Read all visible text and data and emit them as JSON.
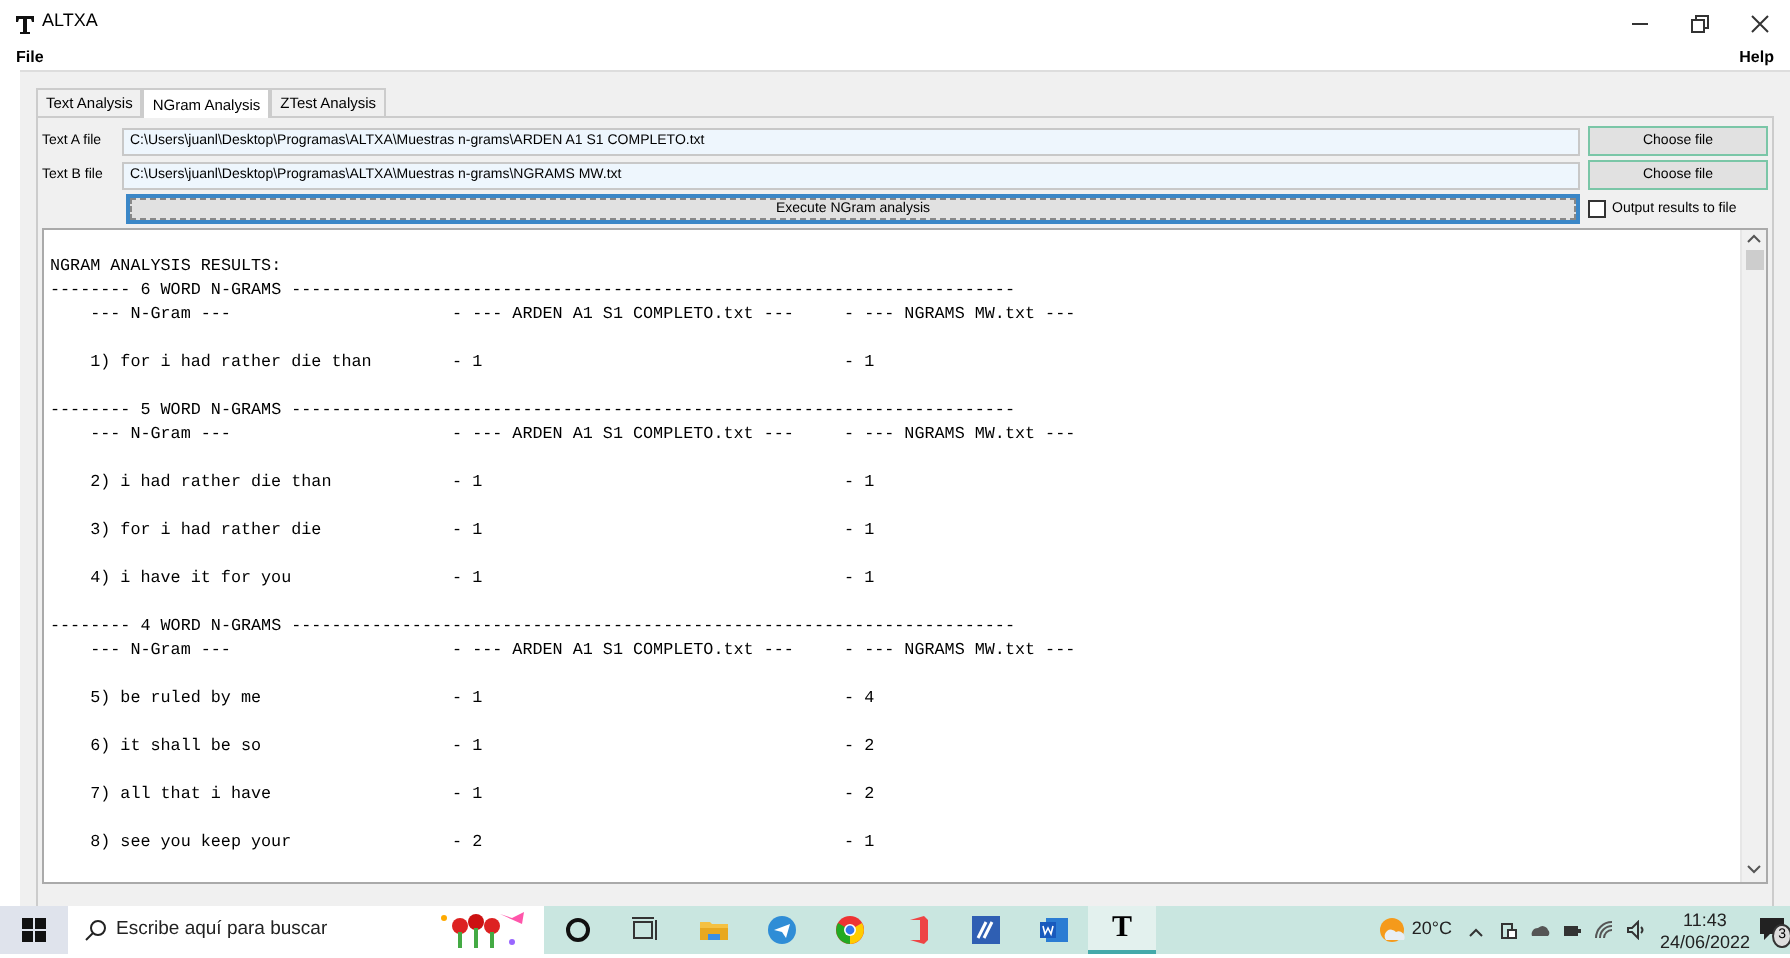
{
  "window": {
    "title": "ALTXA"
  },
  "menu": [
    "File",
    "Help"
  ],
  "tabs": [
    {
      "label": "Text Analysis",
      "selected": false
    },
    {
      "label": "NGram Analysis",
      "selected": true
    },
    {
      "label": "ZTest Analysis",
      "selected": false
    }
  ],
  "files": [
    {
      "label": "Text A file",
      "value": "C:\\Users\\juanl\\Desktop\\Programas\\ALTXA\\Muestras n-grams\\ARDEN A1 S1 COMPLETO.txt",
      "button": "Choose file"
    },
    {
      "label": "Text B file",
      "value": "C:\\Users\\juanl\\Desktop\\Programas\\ALTXA\\Muestras n-grams\\NGRAMS MW.txt",
      "button": "Choose file"
    }
  ],
  "execute_button": "Execute NGram analysis",
  "output_to_file": {
    "label": "Output results to file",
    "checked": false
  },
  "results": [
    {
      "kind": "title",
      "text": "NGRAM ANALYSIS RESULTS:"
    },
    {
      "kind": "rule",
      "text": "-------- 6 WORD N-GRAMS ------------------------------------------------------------------------"
    },
    {
      "kind": "header",
      "cells": [
        "--- N-Gram ---",
        "- --- ARDEN A1 S1 COMPLETO.txt ---",
        "- --- NGRAMS MW.txt ---"
      ]
    },
    {
      "kind": "item",
      "cells": [
        "1) for i had rather die than",
        "- 1",
        "- 1"
      ]
    },
    {
      "kind": "rule",
      "text": "-------- 5 WORD N-GRAMS ------------------------------------------------------------------------"
    },
    {
      "kind": "header",
      "cells": [
        "--- N-Gram ---",
        "- --- ARDEN A1 S1 COMPLETO.txt ---",
        "- --- NGRAMS MW.txt ---"
      ]
    },
    {
      "kind": "item",
      "cells": [
        "2) i had rather die than",
        "- 1",
        "- 1"
      ]
    },
    {
      "kind": "item",
      "cells": [
        "3) for i had rather die",
        "- 1",
        "- 1"
      ]
    },
    {
      "kind": "item",
      "cells": [
        "4) i have it for you",
        "- 1",
        "- 1"
      ]
    },
    {
      "kind": "rule",
      "text": "-------- 4 WORD N-GRAMS ------------------------------------------------------------------------"
    },
    {
      "kind": "header",
      "cells": [
        "--- N-Gram ---",
        "- --- ARDEN A1 S1 COMPLETO.txt ---",
        "- --- NGRAMS MW.txt ---"
      ]
    },
    {
      "kind": "item",
      "cells": [
        "5) be ruled by me",
        "- 1",
        "- 4"
      ]
    },
    {
      "kind": "item",
      "cells": [
        "6) it shall be so",
        "- 1",
        "- 2"
      ]
    },
    {
      "kind": "item",
      "cells": [
        "7) all that i have",
        "- 1",
        "- 2"
      ]
    },
    {
      "kind": "item",
      "cells": [
        "8) see you keep your",
        "- 2",
        "- 1"
      ]
    }
  ],
  "taskbar": {
    "search_placeholder": "Escribe aquí para buscar",
    "apps": [
      {
        "kind": "cortana",
        "active": false
      },
      {
        "kind": "taskview",
        "active": false
      },
      {
        "kind": "folder",
        "active": false
      },
      {
        "kind": "telegram",
        "active": false
      },
      {
        "kind": "chrome",
        "active": false
      },
      {
        "kind": "office",
        "active": false
      },
      {
        "kind": "pen",
        "active": false
      },
      {
        "kind": "word",
        "active": false
      },
      {
        "kind": "altxa",
        "active": true,
        "glyph": "T"
      }
    ],
    "temperature": "20°C",
    "time": "11:43",
    "date": "24/06/2022",
    "notifications": "3"
  }
}
